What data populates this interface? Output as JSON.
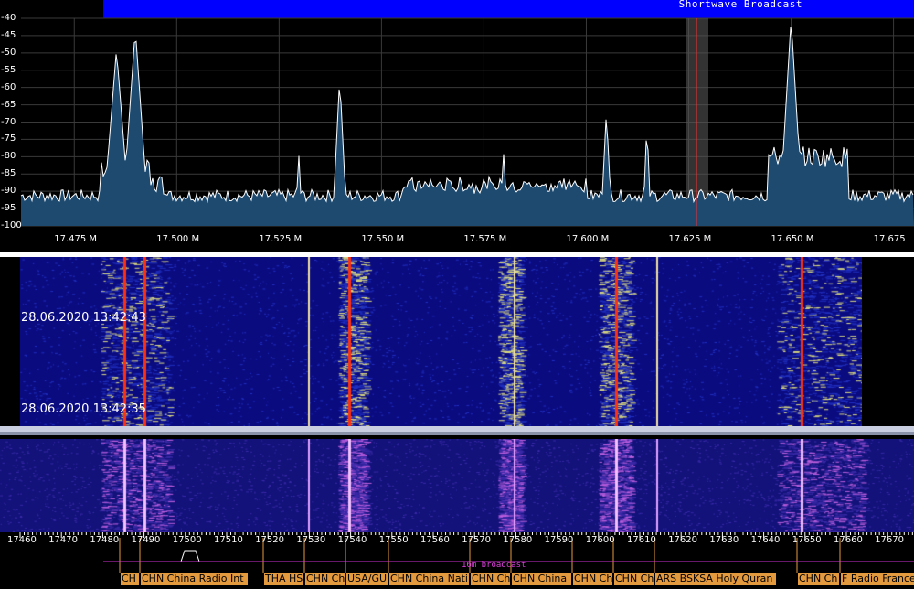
{
  "band_bar": {
    "title": "Shortwave Broadcast",
    "color": "#0000ff"
  },
  "spectrum": {
    "y_ticks": [
      "-40",
      "-45",
      "-50",
      "-55",
      "-60",
      "-65",
      "-70",
      "-75",
      "-80",
      "-85",
      "-90",
      "-95",
      "-100"
    ],
    "x_ticks": [
      "17.475 M",
      "17.500 M",
      "17.525 M",
      "17.550 M",
      "17.575 M",
      "17.600 M",
      "17.625 M",
      "17.650 M",
      "17.675"
    ],
    "peaks_mhz": [
      17.485,
      17.49,
      17.53,
      17.54,
      17.58,
      17.605,
      17.615,
      17.65
    ],
    "cursor_mhz": 17.625,
    "fill_color": "#1e4a70",
    "line_color": "#ffffff",
    "cursor_color": "#ff3030"
  },
  "waterfall": {
    "timestamp_top": "28.06.2020 13:42:43",
    "timestamp_bottom": "28.06.2020 13:42:35",
    "background_color": "#0a0a7a"
  },
  "scale": {
    "ticks": [
      "17460",
      "17470",
      "17480",
      "17490",
      "17500",
      "17510",
      "17520",
      "17530",
      "17540",
      "17550",
      "17560",
      "17570",
      "17580",
      "17590",
      "17600",
      "17610",
      "17620",
      "17630",
      "17640",
      "17650",
      "17660",
      "17670"
    ],
    "band_label": "16m broadcast",
    "stations": [
      {
        "name": "CH",
        "start": 131,
        "width": 21
      },
      {
        "name": "CHN China Radio Int",
        "start": 153,
        "width": 118
      },
      {
        "name": "THA HS",
        "start": 288,
        "width": 44
      },
      {
        "name": "CHN Ch",
        "start": 333,
        "width": 44
      },
      {
        "name": "USA/GU",
        "start": 378,
        "width": 46
      },
      {
        "name": "CHN China Nati",
        "start": 425,
        "width": 88
      },
      {
        "name": "CHN Ch",
        "start": 514,
        "width": 44
      },
      {
        "name": "CHN China",
        "start": 559,
        "width": 66
      },
      {
        "name": "CHN Ch",
        "start": 626,
        "width": 44
      },
      {
        "name": "CHN Ch",
        "start": 671,
        "width": 44
      },
      {
        "name": "ARS BSKSA Holy Quran",
        "start": 716,
        "width": 133
      },
      {
        "name": "CHN Ch",
        "start": 872,
        "width": 46
      },
      {
        "name": "F Radio France",
        "start": 919,
        "width": 81
      }
    ]
  }
}
